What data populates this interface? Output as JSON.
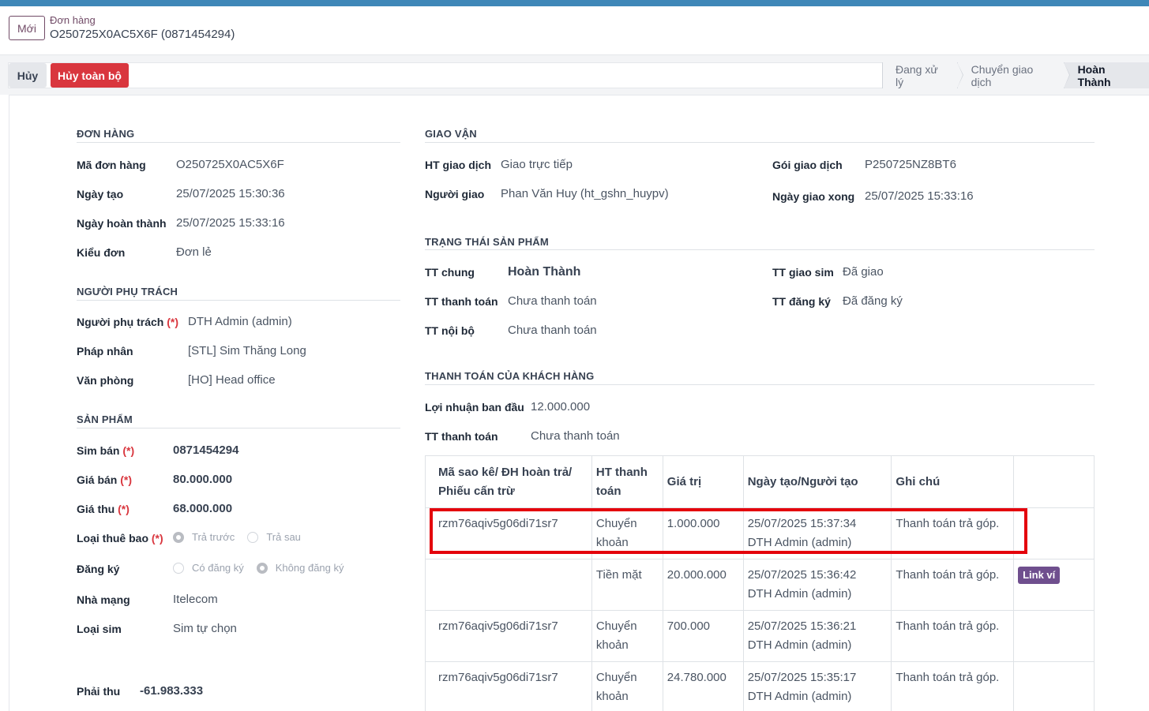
{
  "header": {
    "new_button": "Mới",
    "breadcrumb_parent": "Đơn hàng",
    "breadcrumb_current": "O250725X0AC5X6F (0871454294)"
  },
  "actions": {
    "cancel": "Hủy",
    "cancel_all": "Hủy toàn bộ"
  },
  "statusbar": {
    "steps": [
      "Đang xử lý",
      "Chuyển giao dịch",
      "Hoàn Thành"
    ],
    "active": "Hoàn Thành"
  },
  "order": {
    "title": "ĐƠN HÀNG",
    "code_label": "Mã đơn hàng",
    "code": "O250725X0AC5X6F",
    "created_label": "Ngày tạo",
    "created": "25/07/2025 15:30:36",
    "completed_label": "Ngày hoàn thành",
    "completed": "25/07/2025 15:33:16",
    "type_label": "Kiểu đơn",
    "type": "Đơn lẻ"
  },
  "owner": {
    "title": "NGƯỜI PHỤ TRÁCH",
    "person_label": "Người phụ trách",
    "person": "DTH Admin (admin)",
    "legal_label": "Pháp nhân",
    "legal": "[STL] Sim Thăng Long",
    "office_label": "Văn phòng",
    "office": "[HO] Head office"
  },
  "product": {
    "title": "SẢN PHẨM",
    "sim_label": "Sim bán",
    "sim": "0871454294",
    "price_label": "Giá bán",
    "price": "80.000.000",
    "collect_label": "Giá thu",
    "collect": "68.000.000",
    "sub_type_label": "Loại thuê bao",
    "sub_type_options": [
      "Trả trước",
      "Trả sau"
    ],
    "sub_type_selected": "Trả trước",
    "register_label": "Đăng ký",
    "register_options": [
      "Có đăng ký",
      "Không đăng ký"
    ],
    "register_selected": "Không đăng ký",
    "carrier_label": "Nhà mạng",
    "carrier": "Itelecom",
    "sim_type_label": "Loại sim",
    "sim_type": "Sim tự chọn",
    "required_mark": "(*)"
  },
  "receivable": {
    "label": "Phải thu",
    "value": "-61.983.333"
  },
  "delivery": {
    "title": "GIAO VẬN",
    "method_label": "HT giao dịch",
    "method": "Giao trực tiếp",
    "courier_label": "Người giao",
    "courier": "Phan Văn Huy (ht_gshn_huypv)",
    "package_label": "Gói giao dịch",
    "package": "P250725NZ8BT6",
    "done_label": "Ngày giao xong",
    "done": "25/07/2025 15:33:16"
  },
  "product_status": {
    "title": "TRẠNG THÁI SẢN PHẨM",
    "general_label": "TT chung",
    "general": "Hoàn Thành",
    "payment_label": "TT thanh toán",
    "payment": "Chưa thanh toán",
    "internal_label": "TT nội bộ",
    "internal": "Chưa thanh toán",
    "sim_delivery_label": "TT giao sim",
    "sim_delivery": "Đã giao",
    "registration_label": "TT đăng ký",
    "registration": "Đã đăng ký"
  },
  "customer_payment": {
    "title": "THANH TOÁN CỦA KHÁCH HÀNG",
    "profit_label": "Lợi nhuận ban đầu",
    "profit": "12.000.000",
    "status_label": "TT thanh toán",
    "status": "Chưa thanh toán",
    "columns": [
      "Mã sao kê/ ĐH hoàn trả/ Phiếu cấn trừ",
      "HT thanh toán",
      "Giá trị",
      "Ngày tạo/Người tạo",
      "Ghi chú",
      ""
    ],
    "rows": [
      {
        "code": "rzm76aqiv5g06di71sr7",
        "method": "Chuyển khoản",
        "amount": "1.000.000",
        "date": "25/07/2025 15:37:34",
        "user": "DTH Admin (admin)",
        "note": "Thanh toán trả góp.",
        "link": ""
      },
      {
        "code": "",
        "method": "Tiền mặt",
        "amount": "20.000.000",
        "date": "25/07/2025 15:36:42",
        "user": "DTH Admin (admin)",
        "note": "Thanh toán trả góp.",
        "link": "Link ví"
      },
      {
        "code": "rzm76aqiv5g06di71sr7",
        "method": "Chuyển khoản",
        "amount": "700.000",
        "date": "25/07/2025 15:36:21",
        "user": "DTH Admin (admin)",
        "note": "Thanh toán trả góp.",
        "link": ""
      },
      {
        "code": "rzm76aqiv5g06di71sr7",
        "method": "Chuyển khoản",
        "amount": "24.780.000",
        "date": "25/07/2025 15:35:17",
        "user": "DTH Admin (admin)",
        "note": "Thanh toán trả góp.",
        "link": ""
      }
    ]
  },
  "colors": {
    "accent": "#714b67",
    "danger": "#d9363e",
    "topbar": "#3f87b8",
    "highlight": "#e4030c"
  }
}
